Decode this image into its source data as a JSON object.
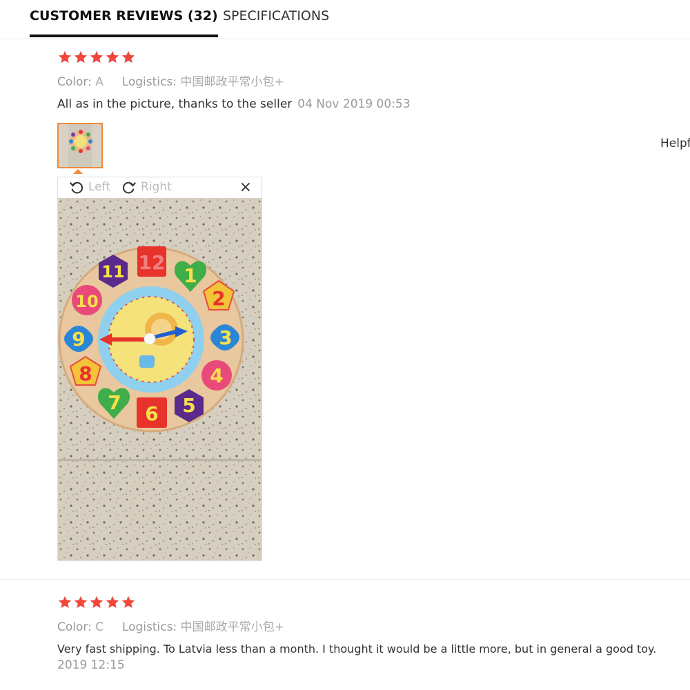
{
  "tabs": {
    "reviews": "CUSTOMER REVIEWS (32)",
    "specifications": "SPECIFICATIONS"
  },
  "reviews": [
    {
      "rating": 5,
      "color_label": "Color:",
      "color_value": "A",
      "logistics_label": "Logistics:",
      "logistics_value": "中国邮政平常小包+",
      "text": "All as in the picture, thanks to the seller",
      "date": "04 Nov 2019 00:53"
    },
    {
      "rating": 5,
      "color_label": "Color:",
      "color_value": "C",
      "logistics_label": "Logistics:",
      "logistics_value": "中国邮政平常小包+",
      "text": "Very fast shipping. To Latvia less than a month. I thought it would be a little more, but in general a good toy.",
      "date": "2019 12:15"
    }
  ],
  "viewer": {
    "rotate_left": "Left",
    "rotate_right": "Right",
    "close": "×"
  },
  "clock_numbers": [
    "12",
    "1",
    "2",
    "3",
    "4",
    "5",
    "6",
    "7",
    "8",
    "9",
    "10",
    "11"
  ],
  "helpful": "Helpf",
  "colors": {
    "star": "#f0463c",
    "accent": "#f08a3c"
  }
}
